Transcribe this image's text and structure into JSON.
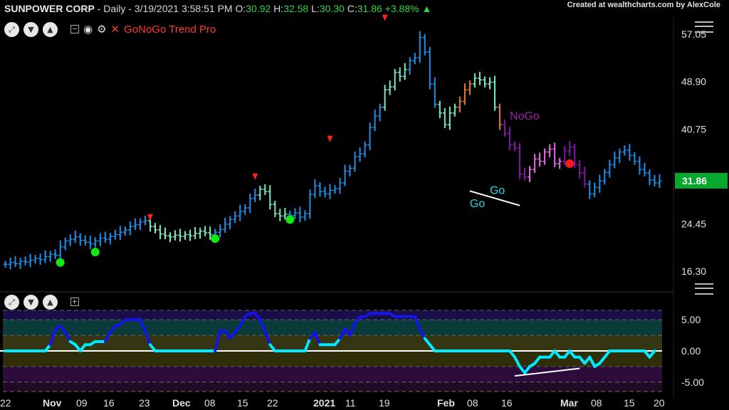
{
  "header": {
    "symbol": "SUNPOWER CORP",
    "info": " - Daily - 3/19/2021 3:58:51 PM ",
    "open_label": "O:",
    "open_value": "30.92",
    "high_label": " H:",
    "high_value": "32.58",
    "low_label": " L:",
    "low_value": "30.30",
    "close_label": " C:",
    "close_value": "31.86",
    "change": " +3.88% ",
    "change_arrow": "▲",
    "credit": "Created at wealthcharts.com by AlexCole"
  },
  "indicator_name": "GoNoGo Trend Pro",
  "icons": [
    "gear-icon",
    "eye-icon",
    "collapse-icon",
    "close-icon",
    "settings-icon"
  ],
  "colors": {
    "go_strong": "#1e90e8",
    "go_weak": "#7de8c0",
    "nogo_strong": "#7d1aa0",
    "nogo_weak": "#e070e0",
    "amber": "#e37c2a",
    "oscillator_high": "#1414e6",
    "oscillator_mid": "#00eaff",
    "price_tag": "#06a82e",
    "label_go": "#18d8e8",
    "label_nogo": "#a020a8"
  },
  "chart_data": [
    {
      "type": "bar",
      "subtype": "ohlc",
      "title": "",
      "ylim": [
        13.0,
        60.0
      ],
      "yticks": [
        "57.05",
        "48.90",
        "40.75",
        "24.45",
        "16.30"
      ],
      "last_price_tag": "31.86",
      "xticks": [
        "22",
        "Nov",
        "09",
        "16",
        "23",
        "Dec",
        "08",
        "15",
        "22",
        "2021",
        "11",
        "19",
        "Feb",
        "08",
        "16",
        "Mar",
        "08",
        "15",
        "20"
      ],
      "close": [
        17.5,
        17.8,
        17.6,
        18.0,
        17.9,
        18.2,
        18.5,
        18.3,
        18.8,
        19.2,
        19.0,
        20.5,
        21.5,
        21.8,
        22.2,
        21.6,
        21.3,
        21.0,
        21.5,
        22.0,
        21.8,
        22.3,
        22.6,
        23.0,
        23.4,
        24.0,
        24.3,
        24.8,
        25.0,
        24.0,
        23.4,
        22.7,
        22.4,
        22.2,
        22.5,
        22.3,
        22.6,
        22.4,
        22.8,
        23.2,
        22.9,
        22.6,
        23.0,
        23.5,
        24.4,
        25.2,
        25.8,
        26.6,
        27.2,
        28.8,
        29.4,
        30.4,
        30.0,
        27.8,
        26.2,
        25.8,
        26.1,
        25.9,
        26.3,
        25.6,
        26.2,
        29.5,
        31.0,
        30.0,
        29.6,
        30.2,
        30.5,
        31.5,
        33.5,
        34.0,
        36.0,
        36.5,
        38.0,
        41.0,
        43.0,
        44.5,
        47.5,
        48.0,
        50.5,
        49.8,
        51.0,
        52.5,
        53.0,
        56.5,
        54.0,
        48.5,
        45.0,
        43.5,
        41.5,
        43.5,
        44.5,
        45.5,
        47.5,
        48.5,
        49.5,
        49.2,
        48.5,
        48.8,
        44.5,
        41.5,
        40.0,
        38.0,
        37.5,
        33.0,
        32.5,
        33.8,
        35.6,
        35.2,
        36.8,
        37.3,
        34.8,
        35.2,
        37.0,
        37.6,
        34.6,
        33.2,
        31.3,
        29.6,
        30.7,
        31.8,
        33.3,
        34.6,
        35.8,
        36.8,
        37.1,
        36.2,
        35.2,
        33.8,
        33.2,
        32.0,
        31.5,
        31.86
      ],
      "rsi_like_signals": {
        "red_triangles": [
          [
            29,
            25.5
          ],
          [
            50,
            32.5
          ],
          [
            65,
            39.0
          ],
          [
            76,
            59.8
          ]
        ],
        "green_dots": [
          [
            11,
            17.8
          ],
          [
            18,
            19.6
          ],
          [
            42,
            21.9
          ],
          [
            57,
            25.2
          ]
        ],
        "red_dots": [
          [
            113,
            34.8
          ]
        ]
      },
      "trend_labels": [
        {
          "text": "NoGo",
          "x": 101,
          "y": 42.4,
          "color": "label_nogo"
        },
        {
          "text": "Go",
          "x": 97,
          "y": 29.6,
          "color": "label_go"
        },
        {
          "text": "Go",
          "x": 93,
          "y": 27.3,
          "color": "label_go"
        }
      ],
      "trendline": {
        "from": [
          93,
          30.1
        ],
        "to": [
          103,
          27.6
        ]
      },
      "bar_phases": [
        {
          "from": 0,
          "to": 29,
          "phase": "go_strong"
        },
        {
          "from": 29,
          "to": 42,
          "phase": "go_weak"
        },
        {
          "from": 42,
          "to": 51,
          "phase": "go_strong"
        },
        {
          "from": 51,
          "to": 57,
          "phase": "go_weak"
        },
        {
          "from": 57,
          "to": 76,
          "phase": "go_strong"
        },
        {
          "from": 76,
          "to": 81,
          "phase": "go_weak"
        },
        {
          "from": 81,
          "to": 87,
          "phase": "go_strong"
        },
        {
          "from": 87,
          "to": 91,
          "phase": "go_weak"
        },
        {
          "from": 91,
          "to": 94,
          "phase": "amber"
        },
        {
          "from": 94,
          "to": 99,
          "phase": "go_weak"
        },
        {
          "from": 99,
          "to": 100,
          "phase": "amber"
        },
        {
          "from": 100,
          "to": 105,
          "phase": "nogo_strong"
        },
        {
          "from": 105,
          "to": 112,
          "phase": "nogo_weak"
        },
        {
          "from": 112,
          "to": 117,
          "phase": "nogo_strong"
        }
      ]
    },
    {
      "type": "line",
      "title": "",
      "ylim": [
        -6.5,
        6.5
      ],
      "yticks": [
        "5.00",
        "0.00",
        "-5.00"
      ],
      "values": [
        0,
        0,
        0,
        0,
        0,
        0,
        0,
        0,
        0,
        1,
        3.5,
        4,
        3,
        1.5,
        1,
        0,
        1,
        1,
        1.5,
        1.5,
        1.5,
        3,
        4,
        4.2,
        5,
        5,
        5,
        5,
        3.2,
        1,
        0,
        0,
        0,
        0,
        0,
        0,
        0,
        0,
        0,
        0,
        0,
        0,
        0,
        3.2,
        3.2,
        2,
        3,
        4,
        5.5,
        6,
        6,
        5,
        3.2,
        1,
        0,
        0,
        0,
        0,
        0,
        0,
        0,
        2,
        3,
        1,
        1,
        1,
        1,
        2,
        3.5,
        2.5,
        4.5,
        5.5,
        5.5,
        6,
        6,
        6,
        6,
        6,
        5.5,
        5.5,
        5.5,
        5.5,
        5.5,
        3.5,
        2,
        1,
        0,
        0,
        0,
        0,
        0,
        0,
        0,
        0,
        0,
        0,
        0,
        0,
        0,
        0,
        0,
        0,
        -1,
        -2.5,
        -3.5,
        -2.5,
        -2,
        -1,
        -1,
        -1,
        0,
        -1,
        -1,
        0,
        -1,
        -1,
        -2,
        -1,
        -2.5,
        -2,
        -1,
        0,
        0,
        0,
        0,
        0,
        0,
        0,
        0,
        -1,
        0
      ],
      "levels": [
        5.0,
        0.0,
        -5.0
      ],
      "divergence_line": {
        "from": [
          102,
          -4.0
        ],
        "to": [
          115,
          -2.8
        ]
      }
    }
  ]
}
